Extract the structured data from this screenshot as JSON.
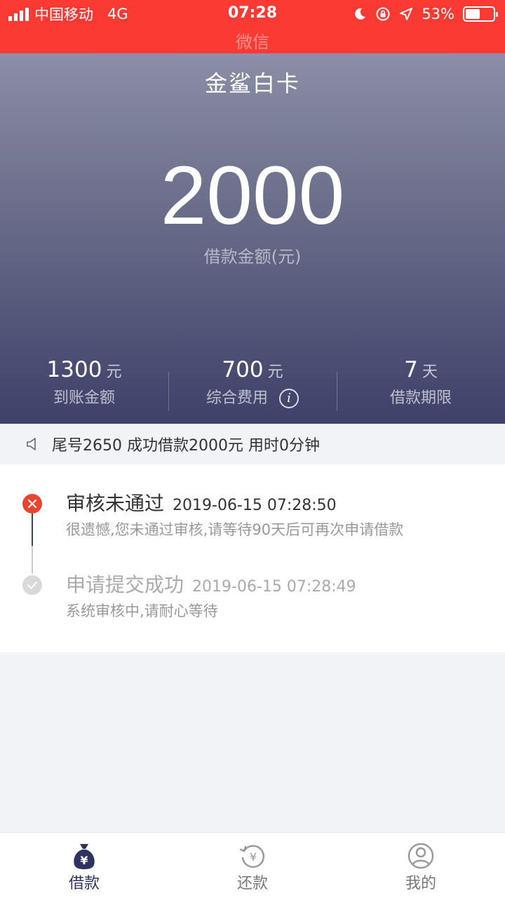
{
  "status_bar": {
    "carrier": "中国移动",
    "network": "4G",
    "time": "07:28",
    "battery": "53%",
    "battery_level": 0.53,
    "back_app": "微信"
  },
  "hero": {
    "title": "金鲨白卡",
    "amount": "2000",
    "amount_label": "借款金额(元)",
    "stats": [
      {
        "value": "1300",
        "unit": "元",
        "label": "到账金额"
      },
      {
        "value": "700",
        "unit": "元",
        "label": "综合费用"
      },
      {
        "value": "7",
        "unit": "天",
        "label": "借款期限"
      }
    ]
  },
  "notice": {
    "text": "尾号2650 成功借款2000元 用时0分钟"
  },
  "timeline": [
    {
      "title": "审核未通过",
      "time": "2019-06-15 07:28:50",
      "desc": "很遗憾,您未通过审核,请等待90天后可再次申请借款"
    },
    {
      "title": "申请提交成功",
      "time": "2019-06-15 07:28:49",
      "desc": "系统审核中,请耐心等待"
    }
  ],
  "tabbar": {
    "items": [
      {
        "label": "借款",
        "icon": "money-bag-icon"
      },
      {
        "label": "还款",
        "icon": "repay-icon"
      },
      {
        "label": "我的",
        "icon": "profile-icon"
      }
    ]
  },
  "colors": {
    "status_bar": "#fb3a33",
    "hero_top": "#8b8ea6",
    "hero_bottom": "#3e4169",
    "reject": "#e8452e",
    "tab_active": "#2f3360",
    "tab_inactive": "#999999"
  }
}
